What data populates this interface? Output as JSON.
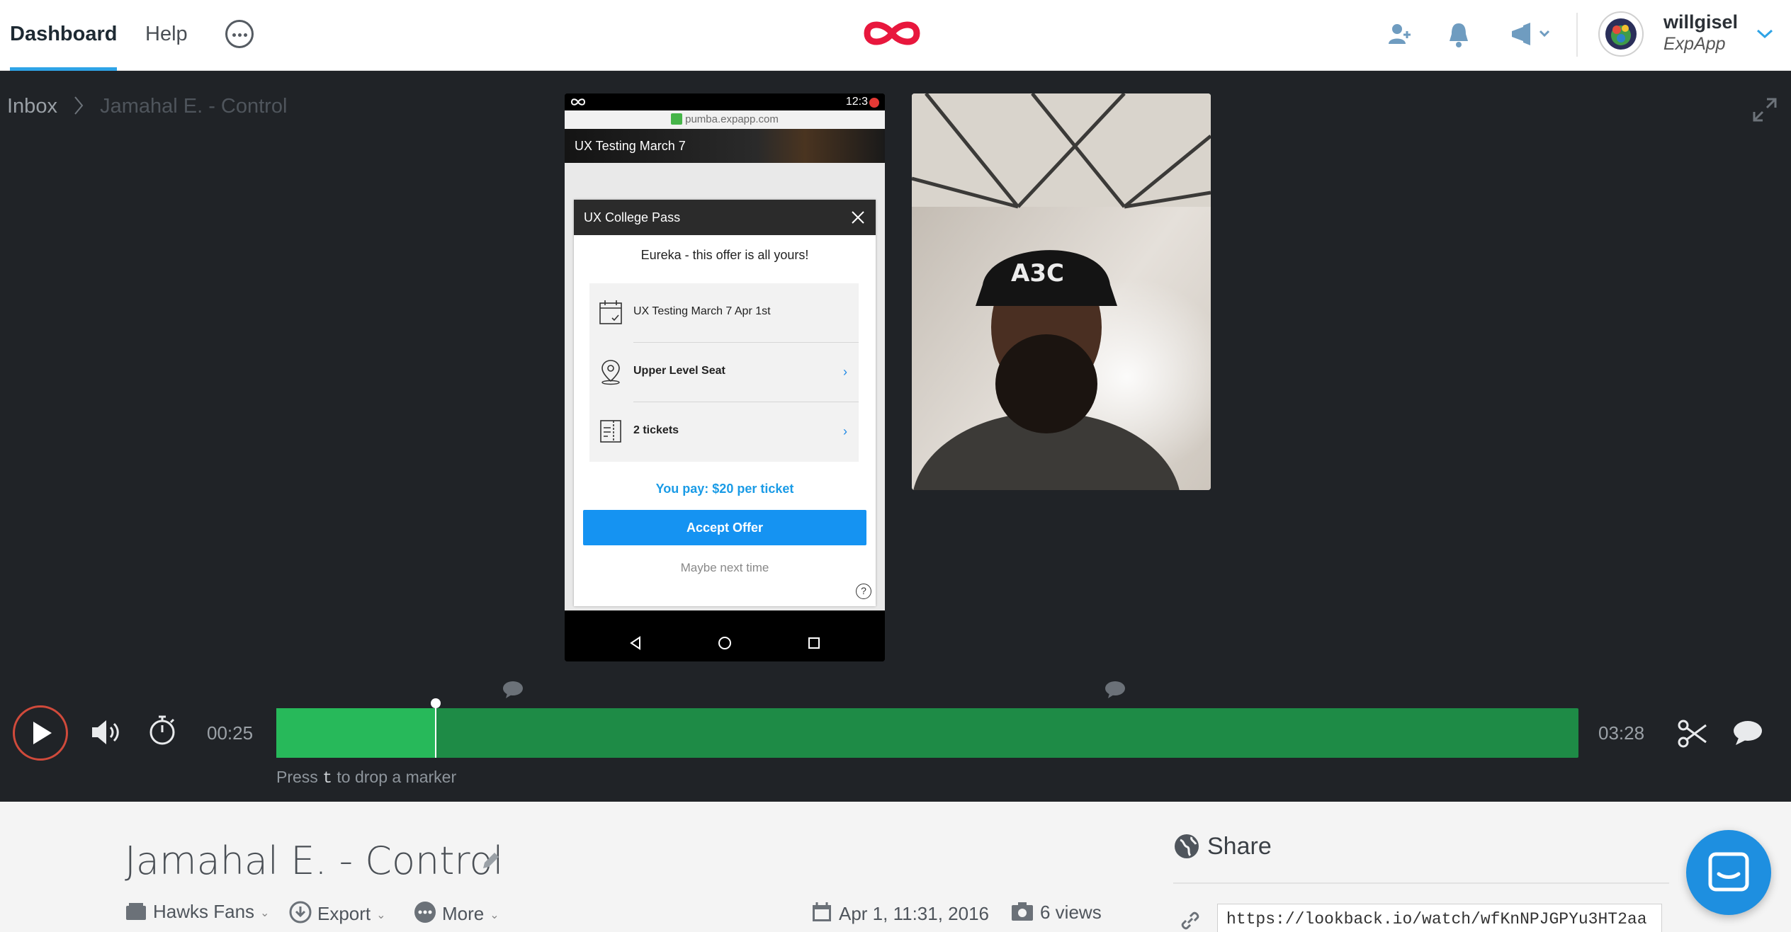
{
  "nav": {
    "tabs": [
      {
        "label": "Dashboard",
        "active": true
      },
      {
        "label": "Help",
        "active": false
      }
    ],
    "more_icon": "ellipsis-circle-icon",
    "logo_icon": "infinity-logo-icon",
    "actions": [
      "add-user-icon",
      "bell-icon",
      "megaphone-icon"
    ],
    "user": {
      "name": "willgisel",
      "org": "ExpApp"
    }
  },
  "breadcrumb": {
    "root": "Inbox",
    "current": "Jamahal E. - Control"
  },
  "phone": {
    "status_time": "12:3",
    "url": "pumba.expapp.com",
    "page_title": "UX Testing March 7",
    "modal": {
      "title": "UX College Pass",
      "message": "Eureka - this offer is all yours!",
      "rows": [
        {
          "icon": "calendar-icon",
          "text": "UX Testing March 7 Apr 1st",
          "bold": false,
          "chevron": false
        },
        {
          "icon": "location-pin-icon",
          "text": "Upper Level Seat",
          "bold": true,
          "chevron": true
        },
        {
          "icon": "ticket-icon",
          "text": "2 tickets",
          "bold": true,
          "chevron": true
        }
      ],
      "price_line": "You pay: $20 per ticket",
      "accept_label": "Accept Offer",
      "decline_label": "Maybe next time",
      "help_label": "?"
    }
  },
  "player": {
    "current_time": "00:25",
    "total_time": "03:28",
    "progress": 0.122,
    "marker_hint_prefix": "Press",
    "marker_hint_key": "t",
    "marker_hint_suffix": "to drop a marker"
  },
  "recording": {
    "title": "Jamahal E. - Control",
    "project": "Hawks Fans",
    "export_label": "Export",
    "more_label": "More",
    "date": "Apr 1, 11:31, 2016",
    "views": "6 views"
  },
  "share": {
    "heading": "Share",
    "url": "https://lookback.io/watch/wfKnNPJGPYu3HT2aa"
  },
  "colors": {
    "accent": "#2ea3e6",
    "timeline": "#1e8b46",
    "timeline_played": "#27b95a",
    "brand": "#e8173d",
    "cta": "#1593f2"
  }
}
